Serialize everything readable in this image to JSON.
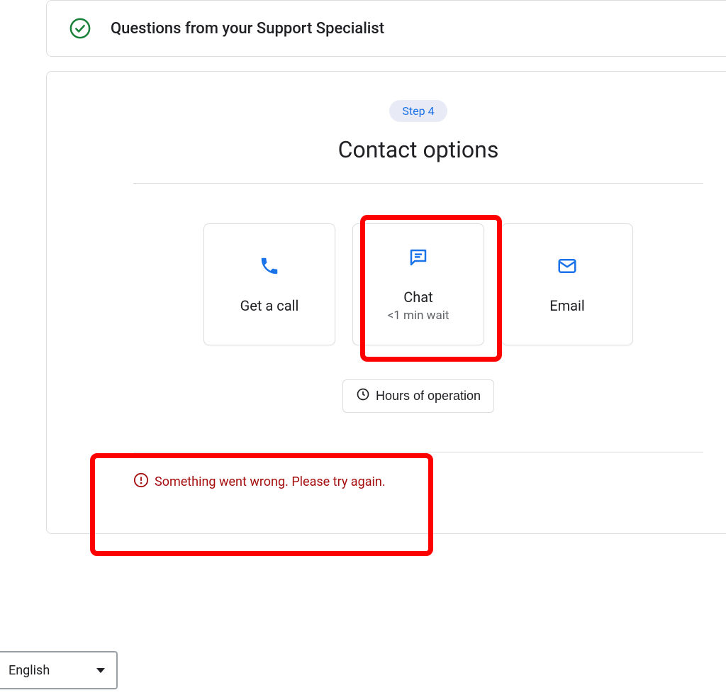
{
  "top_panel": {
    "title": "Questions from your Support Specialist"
  },
  "main_panel": {
    "step_label": "Step 4",
    "title": "Contact options",
    "options": [
      {
        "label": "Get a call",
        "sub": ""
      },
      {
        "label": "Chat",
        "sub": "<1 min wait"
      },
      {
        "label": "Email",
        "sub": ""
      }
    ],
    "hours_button": "Hours of operation",
    "error_message": "Something went wrong. Please try again."
  },
  "language": {
    "selected": "English"
  }
}
